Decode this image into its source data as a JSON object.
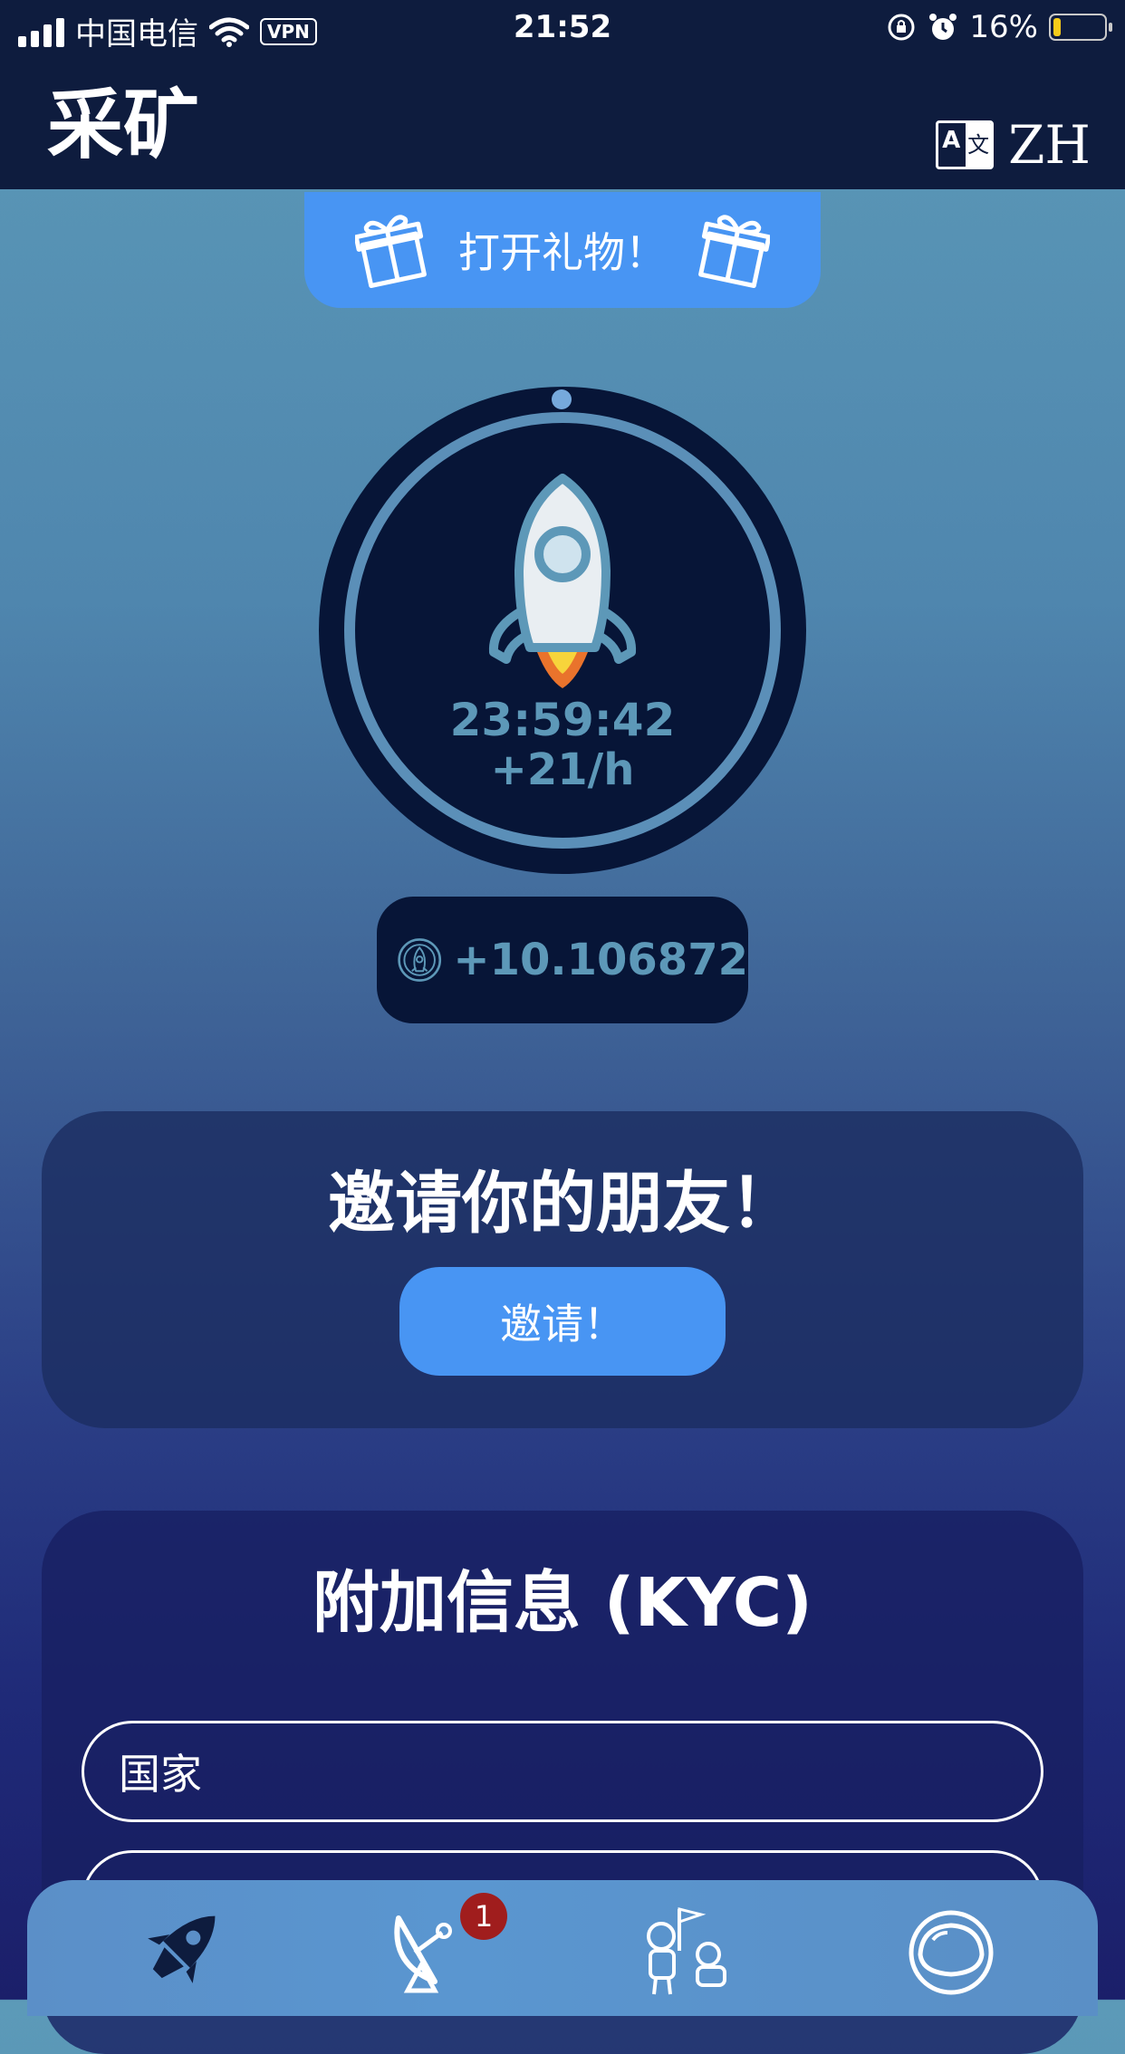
{
  "status_bar": {
    "carrier": "中国电信",
    "vpn": "VPN",
    "time": "21:52",
    "battery_percent": "16%",
    "battery_level": 0.16
  },
  "header": {
    "title": "采矿",
    "language": "ZH"
  },
  "gift": {
    "label": "打开礼物！"
  },
  "mining": {
    "timer": "23:59:42",
    "rate": "+21/h"
  },
  "balance": {
    "value": "+10.106872"
  },
  "invite_card": {
    "title": "邀请你的朋友！",
    "button": "邀请！"
  },
  "kyc_card": {
    "title": "附加信息 (KYC)",
    "country_placeholder": "国家"
  },
  "bottom_nav": {
    "items": [
      {
        "icon": "rocket-icon"
      },
      {
        "icon": "satellite-dish-icon",
        "badge": "1"
      },
      {
        "icon": "astronauts-icon"
      },
      {
        "icon": "helmet-icon"
      }
    ]
  },
  "colors": {
    "header_bg": "#0e1c3e",
    "accent_button": "#4895f3",
    "circle_bg": "#071537",
    "value_text": "#5d98b8",
    "badge": "#a01d1d"
  }
}
